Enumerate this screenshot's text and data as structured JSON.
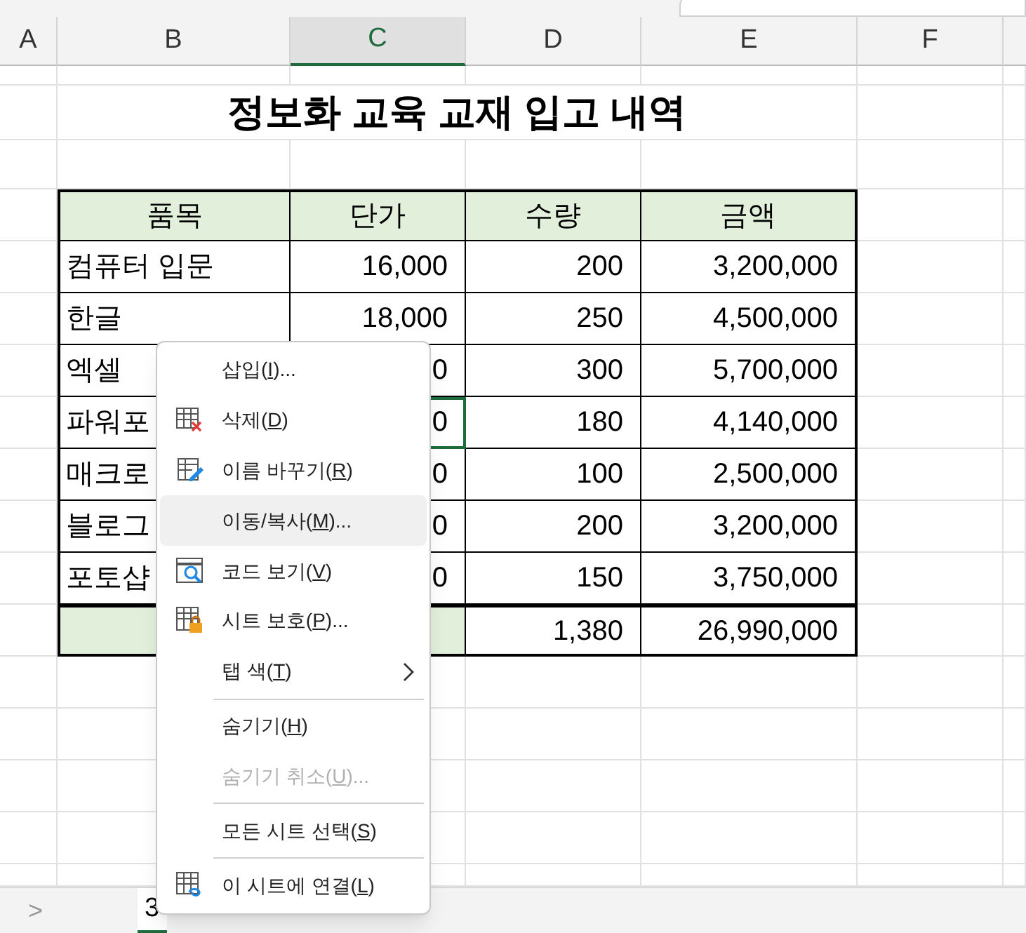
{
  "columns": [
    {
      "label": "A",
      "selected": false
    },
    {
      "label": "B",
      "selected": false
    },
    {
      "label": "C",
      "selected": true
    },
    {
      "label": "D",
      "selected": false
    },
    {
      "label": "E",
      "selected": false
    },
    {
      "label": "F",
      "selected": false
    }
  ],
  "title": "정보화 교육 교재 입고 내역",
  "table": {
    "columns": [
      "품목",
      "단가",
      "수량",
      "금액"
    ],
    "rows": [
      {
        "kind": "item",
        "item": "컴퓨터 입문",
        "price": "16,000",
        "qty": "200",
        "amount": "3,200,000",
        "selected": false
      },
      {
        "kind": "item",
        "item": "한글",
        "price": "18,000",
        "qty": "250",
        "amount": "4,500,000",
        "selected": false
      },
      {
        "kind": "item",
        "item": "엑셀",
        "price": "0",
        "qty": "300",
        "amount": "5,700,000",
        "selected": false
      },
      {
        "kind": "item",
        "item": "파워포",
        "price": "0",
        "qty": "180",
        "amount": "4,140,000",
        "selected": true
      },
      {
        "kind": "item",
        "item": "매크로",
        "price": "0",
        "qty": "100",
        "amount": "2,500,000",
        "selected": false
      },
      {
        "kind": "item",
        "item": "블로그",
        "price": "0",
        "qty": "200",
        "amount": "3,200,000",
        "selected": false
      },
      {
        "kind": "item",
        "item": "포토샵",
        "price": "0",
        "qty": "150",
        "amount": "3,750,000",
        "selected": false
      },
      {
        "kind": "total",
        "qty": "1,380",
        "amount": "26,990,000"
      }
    ]
  },
  "context_menu": [
    {
      "kind": "item",
      "before": "삽입(",
      "key": "I",
      "after": ")...",
      "disabled": false,
      "selected": false
    },
    {
      "kind": "item",
      "before": "삭제(",
      "key": "D",
      "after": ")",
      "disabled": false,
      "selected": false
    },
    {
      "kind": "item",
      "before": "이름 바꾸기(",
      "key": "R",
      "after": ")",
      "disabled": false,
      "selected": false
    },
    {
      "kind": "item",
      "before": "이동/복사(",
      "key": "M",
      "after": ")...",
      "disabled": false,
      "selected": true
    },
    {
      "kind": "item",
      "before": "코드 보기(",
      "key": "V",
      "after": ")",
      "disabled": false,
      "selected": false
    },
    {
      "kind": "item",
      "before": "시트 보호(",
      "key": "P",
      "after": ")...",
      "disabled": false,
      "selected": false
    },
    {
      "kind": "item",
      "before": "탭 색(",
      "key": "T",
      "after": ")",
      "submenu": true,
      "disabled": false,
      "selected": false
    },
    {
      "kind": "separator"
    },
    {
      "kind": "item",
      "before": "숨기기(",
      "key": "H",
      "after": ")",
      "disabled": false,
      "selected": false
    },
    {
      "kind": "item",
      "before": "숨기기 취소(",
      "key": "U",
      "after": ")...",
      "disabled": true,
      "selected": false
    },
    {
      "kind": "separator"
    },
    {
      "kind": "item",
      "before": "모든 시트 선택(",
      "key": "S",
      "after": ")",
      "disabled": false,
      "selected": false
    },
    {
      "kind": "separator"
    },
    {
      "kind": "item",
      "before": "이 시트에 연결(",
      "key": "L",
      "after": ")",
      "disabled": false,
      "selected": false
    }
  ],
  "sheet_tabs": {
    "nav": ">",
    "tabs": [
      {
        "label": "3",
        "selected": true
      }
    ]
  }
}
